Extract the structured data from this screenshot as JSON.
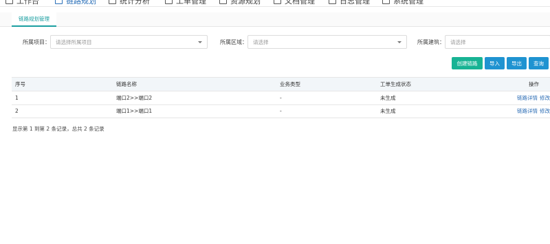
{
  "nav": {
    "items": [
      {
        "label": "工作台",
        "icon": "desktop-icon"
      },
      {
        "label": "链路规划",
        "icon": "route-icon",
        "active": true
      },
      {
        "label": "统计分析",
        "icon": "chart-icon"
      },
      {
        "label": "工单管理",
        "icon": "checklist-icon"
      },
      {
        "label": "资源规划",
        "icon": "resource-icon"
      },
      {
        "label": "文档管理",
        "icon": "document-icon"
      },
      {
        "label": "日志管理",
        "icon": "log-icon"
      },
      {
        "label": "系统管理",
        "icon": "monitor-icon"
      }
    ]
  },
  "tabs": {
    "active": "链路规划管理"
  },
  "filters": {
    "project": {
      "label": "所属项目：",
      "placeholder": "请选择所属项目"
    },
    "region": {
      "label": "所属区域：",
      "placeholder": "请选择"
    },
    "building": {
      "label": "所属建筑：",
      "placeholder": "请选择"
    }
  },
  "toolbar": {
    "create": "创建链路",
    "import": "导入",
    "export": "导出",
    "query": "查询"
  },
  "table": {
    "headers": {
      "index": "序号",
      "name": "链路名称",
      "type": "业务类型",
      "status": "工单生成状态",
      "action": "操作"
    },
    "rows": [
      {
        "index": "1",
        "name": "端口2>>端口2",
        "type": "-",
        "status": "未生成",
        "detail": "链路详情",
        "edit": "修改"
      },
      {
        "index": "2",
        "name": "端口1>>端口1",
        "type": "-",
        "status": "未生成",
        "detail": "链路详情",
        "edit": "修改"
      }
    ]
  },
  "summary": "显示第 1 到第 2 条记录，总共 2 条记录",
  "colors": {
    "accent": "#1a9ea0",
    "green": "#18b394",
    "blue": "#1f93d1",
    "link": "#2f6fb6"
  }
}
